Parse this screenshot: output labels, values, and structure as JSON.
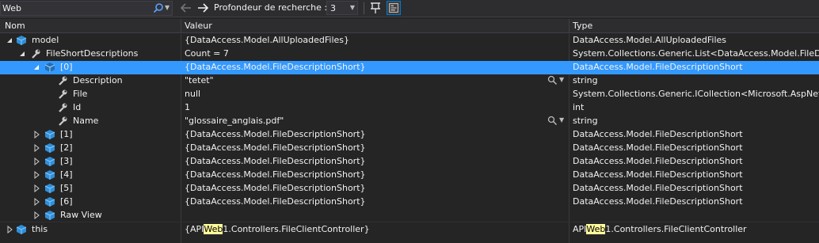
{
  "toolbar": {
    "search_value": "Web",
    "depth_label": "Profondeur de recherche :",
    "depth_value": "3"
  },
  "columns": {
    "name": "Nom",
    "value": "Valeur",
    "type": "Type"
  },
  "rows": {
    "model": {
      "name": "model",
      "value": "{DataAccess.Model.AllUploadedFiles}",
      "type": "DataAccess.Model.AllUploadedFiles"
    },
    "fsd": {
      "name": "FileShortDescriptions",
      "value": "Count = 7",
      "type": "System.Collections.Generic.List<DataAccess.Model.FileDesc"
    },
    "i0": {
      "name": "[0]",
      "value": "{DataAccess.Model.FileDescriptionShort}",
      "type": "DataAccess.Model.FileDescriptionShort"
    },
    "desc": {
      "name": "Description",
      "value": "\"tetet\"",
      "type": "string"
    },
    "file": {
      "name": "File",
      "value": "null",
      "type": "System.Collections.Generic.ICollection<Microsoft.AspNetC"
    },
    "id": {
      "name": "Id",
      "value": "1",
      "type": "int"
    },
    "nm": {
      "name": "Name",
      "value": "\"glossaire_anglais.pdf\"",
      "type": "string"
    },
    "i1": {
      "name": "[1]",
      "value": "{DataAccess.Model.FileDescriptionShort}",
      "type": "DataAccess.Model.FileDescriptionShort"
    },
    "i2": {
      "name": "[2]",
      "value": "{DataAccess.Model.FileDescriptionShort}",
      "type": "DataAccess.Model.FileDescriptionShort"
    },
    "i3": {
      "name": "[3]",
      "value": "{DataAccess.Model.FileDescriptionShort}",
      "type": "DataAccess.Model.FileDescriptionShort"
    },
    "i4": {
      "name": "[4]",
      "value": "{DataAccess.Model.FileDescriptionShort}",
      "type": "DataAccess.Model.FileDescriptionShort"
    },
    "i5": {
      "name": "[5]",
      "value": "{DataAccess.Model.FileDescriptionShort}",
      "type": "DataAccess.Model.FileDescriptionShort"
    },
    "i6": {
      "name": "[6]",
      "value": "{DataAccess.Model.FileDescriptionShort}",
      "type": "DataAccess.Model.FileDescriptionShort"
    },
    "raw": {
      "name": "Raw View",
      "value": "",
      "type": ""
    },
    "this": {
      "name": "this",
      "value_pre": "{API",
      "value_hl": "Web",
      "value_post": "1.Controllers.FileClientController}",
      "type_pre": "API",
      "type_hl": "Web",
      "type_post": "1.Controllers.FileClientController"
    }
  },
  "icons": {
    "object": "cube-icon",
    "property": "wrench-icon",
    "expand": "triangle-icon"
  },
  "colors": {
    "background": "#252526",
    "selection": "#3399ff",
    "highlight": "#fffb9c"
  }
}
